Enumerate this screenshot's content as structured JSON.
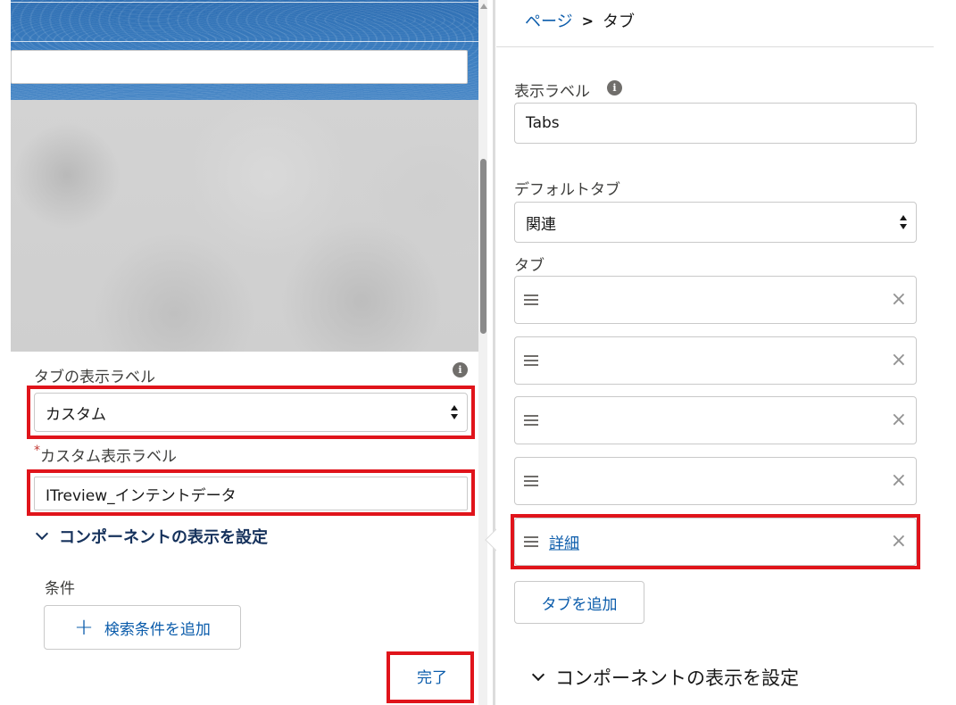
{
  "left_panel": {
    "tab_label_field": {
      "label": "タブの表示ラベル",
      "value": "カスタム"
    },
    "custom_label_field": {
      "required_mark": "*",
      "label": "カスタム表示ラベル",
      "value": "ITreview_インテントデータ"
    },
    "visibility_section": {
      "title": "コンポーネントの表示を設定"
    },
    "conditions": {
      "label": "条件",
      "add_button": "検索条件を追加",
      "add_icon": "+"
    },
    "done_button": "完了"
  },
  "right_panel": {
    "breadcrumb": {
      "parent": "ページ",
      "separator": ">",
      "current": "タブ"
    },
    "display_label_field": {
      "label": "表示ラベル",
      "value": "Tabs"
    },
    "default_tab_field": {
      "label": "デフォルトタブ",
      "value": "関連"
    },
    "tabs": {
      "label": "タブ",
      "items": [
        {
          "label": ""
        },
        {
          "label": ""
        },
        {
          "label": ""
        },
        {
          "label": ""
        },
        {
          "label": "詳細"
        }
      ],
      "remove_icon": "×",
      "add_button": "タブを追加"
    },
    "visibility_section": {
      "title": "コンポーネントの表示を設定"
    }
  },
  "icons": {
    "info": "i"
  },
  "colors": {
    "highlight": "#e0141b",
    "link": "#0b5cab",
    "heading": "#16325c"
  }
}
